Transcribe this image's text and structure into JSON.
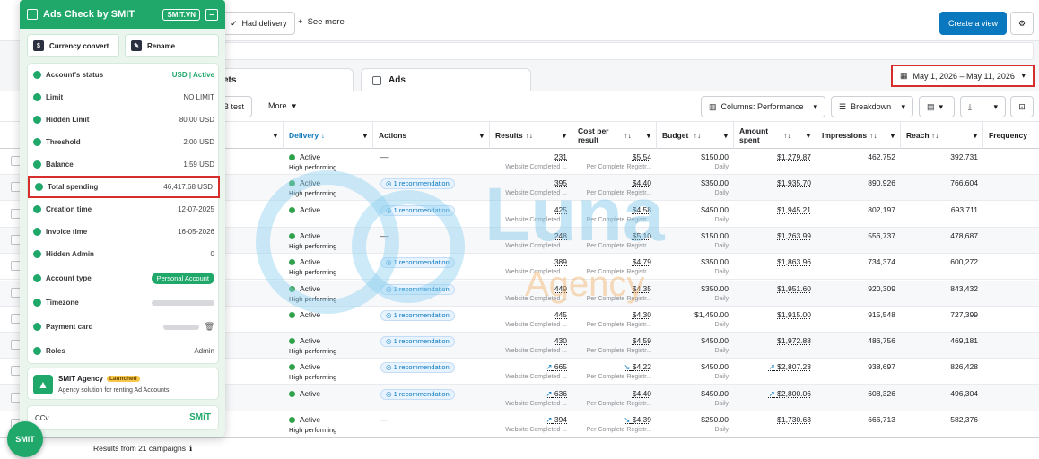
{
  "topbar": {
    "tab_had_delivery": "Had delivery",
    "see_more": "See more",
    "create_view": "Create a view"
  },
  "tabs": {
    "sets_partial": "ets",
    "ads": "Ads"
  },
  "date_range": "May 1, 2026 – May 11, 2026",
  "toolbar": {
    "ab_test_partial": "B test",
    "more": "More",
    "columns": "Columns: Performance",
    "breakdown": "Breakdown"
  },
  "table": {
    "headers": {
      "delivery": "Delivery",
      "actions": "Actions",
      "results": "Results",
      "cost_per_result_1": "Cost per",
      "cost_per_result_2": "result",
      "budget": "Budget",
      "amount_spent_1": "Amount",
      "amount_spent_2": "spent",
      "impressions": "Impressions",
      "reach": "Reach",
      "frequency": "Frequency"
    },
    "results_sub": "Website Completed ...",
    "cost_sub": "Per Complete Registr...",
    "budget_sub": "Daily",
    "recommendation": "1 recommendation",
    "high_performing": "High performing",
    "dash": "—",
    "rows": [
      {
        "delivery": "Active",
        "high": true,
        "action": "dash",
        "results": "231",
        "trend": "",
        "cost": "$5.54",
        "cost_trend": "",
        "budget": "$150.00",
        "spent": "$1,279.87",
        "spent_trend": "",
        "impressions": "462,752",
        "reach": "392,731"
      },
      {
        "delivery": "Active",
        "high": true,
        "action": "rec",
        "results": "395",
        "trend": "",
        "cost": "$4.40",
        "cost_trend": "",
        "budget": "$350.00",
        "spent": "$1,935.70",
        "spent_trend": "",
        "impressions": "890,926",
        "reach": "766,604"
      },
      {
        "delivery": "Active",
        "high": false,
        "action": "rec",
        "results": "425",
        "trend": "",
        "cost": "$4.58",
        "cost_trend": "",
        "budget": "$450.00",
        "spent": "$1,945.21",
        "spent_trend": "",
        "impressions": "802,197",
        "reach": "693,711"
      },
      {
        "delivery": "Active",
        "high": true,
        "action": "dash",
        "results": "248",
        "trend": "",
        "cost": "$5.10",
        "cost_trend": "",
        "budget": "$150.00",
        "spent": "$1,263.99",
        "spent_trend": "",
        "impressions": "556,737",
        "reach": "478,687"
      },
      {
        "delivery": "Active",
        "high": true,
        "action": "rec",
        "results": "389",
        "trend": "",
        "cost": "$4.79",
        "cost_trend": "",
        "budget": "$350.00",
        "spent": "$1,863.96",
        "spent_trend": "",
        "impressions": "734,374",
        "reach": "600,272"
      },
      {
        "delivery": "Active",
        "high": true,
        "action": "rec",
        "results": "449",
        "trend": "",
        "cost": "$4.35",
        "cost_trend": "",
        "budget": "$350.00",
        "spent": "$1,951.60",
        "spent_trend": "",
        "impressions": "920,309",
        "reach": "843,432"
      },
      {
        "delivery": "Active",
        "high": false,
        "action": "rec",
        "results": "445",
        "trend": "",
        "cost": "$4.30",
        "cost_trend": "",
        "budget": "$1,450.00",
        "spent": "$1,915.00",
        "spent_trend": "",
        "impressions": "915,548",
        "reach": "727,399"
      },
      {
        "delivery": "Active",
        "high": true,
        "action": "rec",
        "results": "430",
        "trend": "",
        "cost": "$4.59",
        "cost_trend": "",
        "budget": "$450.00",
        "spent": "$1,972.88",
        "spent_trend": "",
        "impressions": "486,756",
        "reach": "469,181"
      },
      {
        "delivery": "Active",
        "high": true,
        "action": "rec",
        "results": "665",
        "trend": "↗",
        "cost": "$4.22",
        "cost_trend": "↘",
        "budget": "$450.00",
        "spent": "$2,807.23",
        "spent_trend": "↗",
        "impressions": "938,697",
        "reach": "826,428"
      },
      {
        "delivery": "Active",
        "high": false,
        "action": "rec",
        "results": "636",
        "trend": "↗",
        "cost": "$4.40",
        "cost_trend": "",
        "budget": "$450.00",
        "spent": "$2,800.06",
        "spent_trend": "↗",
        "impressions": "608,326",
        "reach": "496,304"
      },
      {
        "delivery": "Active",
        "high": true,
        "action": "dash",
        "results": "394",
        "trend": "↗",
        "cost": "$4.39",
        "cost_trend": "↘",
        "budget": "$250.00",
        "spent": "$1,730.63",
        "spent_trend": "",
        "impressions": "666,713",
        "reach": "582,376"
      }
    ]
  },
  "footer": {
    "results_from": "Results from 21 campaigns"
  },
  "extension": {
    "title": "Ads Check by SMIT",
    "chip": "SMIT.VN",
    "minimize": "–",
    "currency_convert": "Currency convert",
    "rename": "Rename",
    "items": [
      {
        "label": "Account's status",
        "value": "USD | Active"
      },
      {
        "label": "Limit",
        "value": "NO LIMIT"
      },
      {
        "label": "Hidden Limit",
        "value": "80.00 USD"
      },
      {
        "label": "Threshold",
        "value": "2.00 USD"
      },
      {
        "label": "Balance",
        "value": "1.59 USD"
      },
      {
        "label": "Total spending",
        "value": "46,417.68 USD"
      },
      {
        "label": "Creation time",
        "value": "12-07-2025"
      },
      {
        "label": "Invoice time",
        "value": "16-05-2026"
      },
      {
        "label": "Hidden Admin",
        "value": "0"
      },
      {
        "label": "Account type",
        "value": "Personal Account"
      },
      {
        "label": "Timezone",
        "value": ""
      },
      {
        "label": "Payment card",
        "value": ""
      },
      {
        "label": "Roles",
        "value": "Admin"
      }
    ],
    "agency_name": "SMIT Agency",
    "agency_tag": "Launched",
    "agency_desc": "Agency solution for renting Ad Accounts",
    "ccv": "CCv",
    "smit_logo": "SMiT",
    "fab": "SMiT"
  },
  "watermark": {
    "line1": "Luna",
    "line2": "Agency"
  },
  "colors": {
    "accent": "#0a78be",
    "smit_green": "#1fa86a",
    "highlight_red": "#d62d2d",
    "active_green": "#31a24c"
  }
}
